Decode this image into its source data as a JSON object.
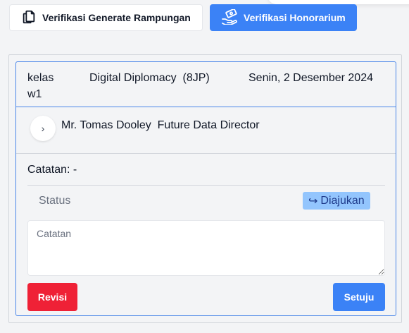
{
  "tabs": {
    "generate": {
      "label": "Verifikasi Generate Rampungan",
      "icon": "copy-document-icon"
    },
    "honorarium": {
      "label": "Verifikasi Honorarium",
      "icon": "hand-money-icon"
    }
  },
  "session": {
    "class_label": "kelas w1",
    "course": "Digital Diplomacy  (8JP)",
    "date": "Senin, 2 Desember 2024"
  },
  "person": {
    "expand_icon": "chevron-right-icon",
    "expand_glyph": "›",
    "name_title": "Mr. Tomas Dooley  Future Data Director"
  },
  "note": {
    "text": "Catatan: -"
  },
  "status": {
    "label": "Status",
    "badge_icon": "share-arrow-icon",
    "badge_glyph": "↪",
    "badge_text": "Diajukan"
  },
  "form": {
    "placeholder": "Catatan",
    "value": ""
  },
  "actions": {
    "reject_label": "Revisi",
    "approve_label": "Setuju"
  },
  "colors": {
    "primary": "#3b82f6",
    "danger": "#ef2136",
    "card_border": "#4a86e8",
    "badge_bg": "#93c5fd"
  }
}
